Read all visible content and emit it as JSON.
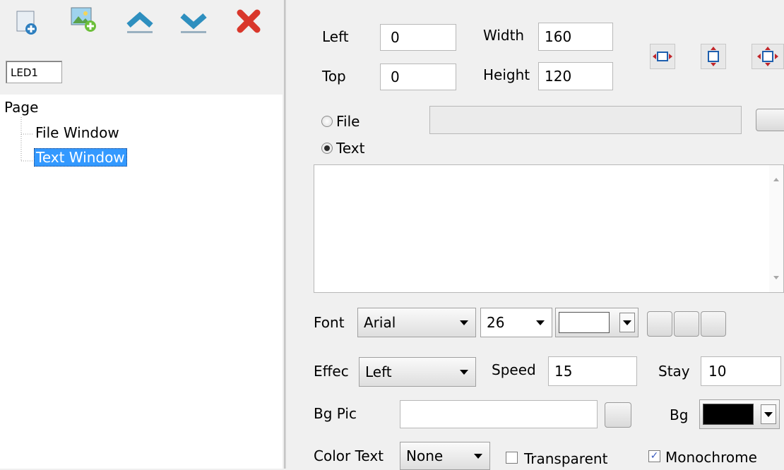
{
  "sidebar": {
    "device_label": "LED1",
    "tree": {
      "root": "Page",
      "children": [
        {
          "label": "File Window",
          "selected": false
        },
        {
          "label": "Text Window",
          "selected": true
        }
      ]
    }
  },
  "position": {
    "left_label": "Left",
    "left_value": "0",
    "top_label": "Top",
    "top_value": "0",
    "width_label": "Width",
    "width_value": "160",
    "height_label": "Height",
    "height_value": "120"
  },
  "source": {
    "file_label": "File",
    "text_label": "Text",
    "selected": "Text",
    "file_path": "",
    "text_content": ""
  },
  "font": {
    "label": "Font",
    "family": "Arial",
    "size": "26",
    "color": "#ffffff"
  },
  "effect": {
    "label": "Effec",
    "value": "Left",
    "speed_label": "Speed",
    "speed_value": "15",
    "stay_label": "Stay",
    "stay_value": "10"
  },
  "background": {
    "bgpic_label": "Bg Pic",
    "bgpic_value": "",
    "bg_label": "Bg",
    "bg_color": "#000000"
  },
  "color_text": {
    "label": "Color Text",
    "value": "None",
    "transparent_label": "Transparent",
    "transparent_checked": false,
    "monochrome_label": "Monochrome",
    "monochrome_checked": true
  },
  "colors": {
    "selection": "#3399ff",
    "toolbar_blue": "#2e8fbf",
    "delete_red": "#d9372b"
  }
}
